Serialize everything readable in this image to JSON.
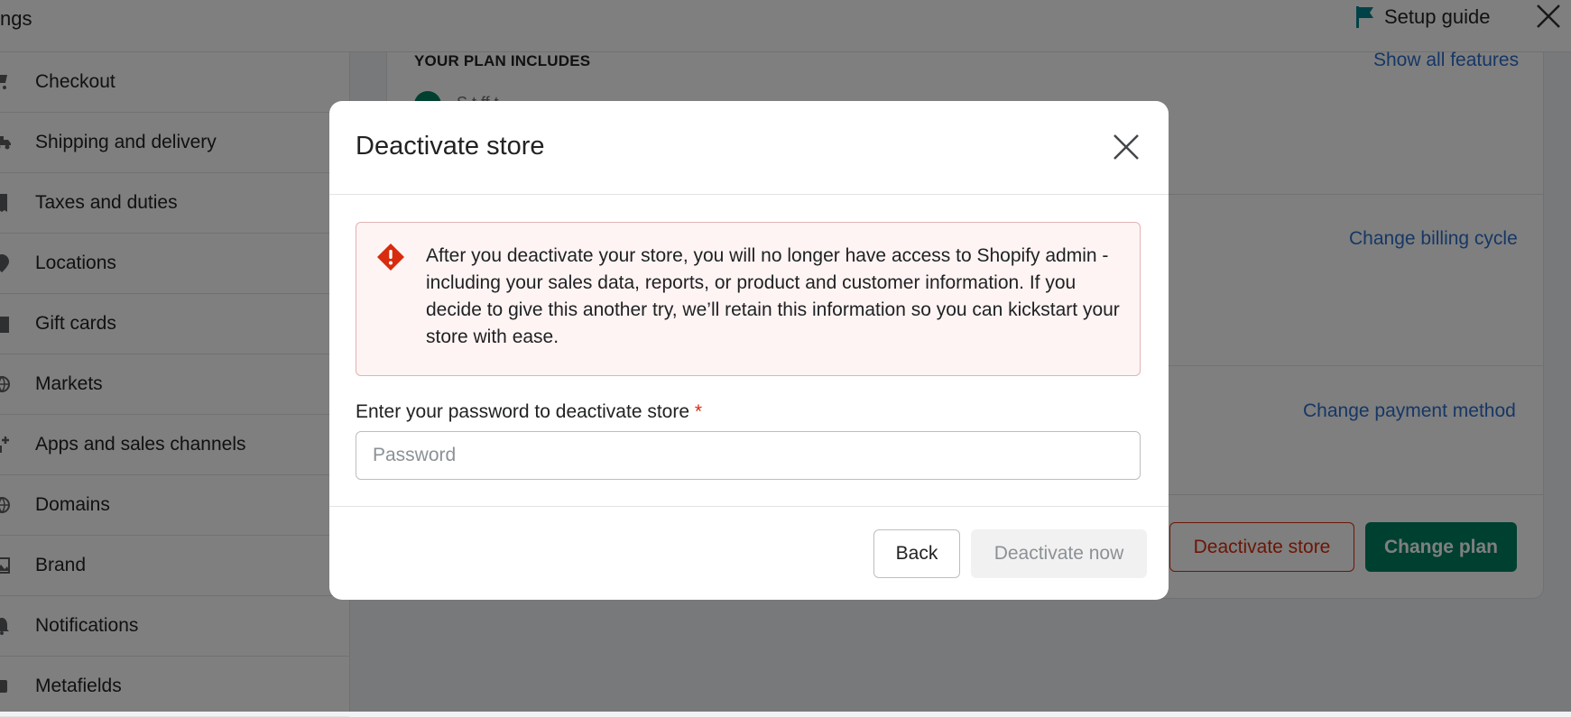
{
  "topbar": {
    "title": "ngs",
    "setup_guide": "Setup guide"
  },
  "sidebar": {
    "items": [
      {
        "label": "Checkout",
        "icon": "cart-icon"
      },
      {
        "label": "Shipping and delivery",
        "icon": "truck-icon"
      },
      {
        "label": "Taxes and duties",
        "icon": "receipt-icon"
      },
      {
        "label": "Locations",
        "icon": "location-pin-icon"
      },
      {
        "label": "Gift cards",
        "icon": "gift-icon"
      },
      {
        "label": "Markets",
        "icon": "globe-icon"
      },
      {
        "label": "Apps and sales channels",
        "icon": "apps-icon"
      },
      {
        "label": "Domains",
        "icon": "globe-icon"
      },
      {
        "label": "Brand",
        "icon": "image-icon"
      },
      {
        "label": "Notifications",
        "icon": "bell-icon"
      },
      {
        "label": "Metafields",
        "icon": "metafields-icon"
      }
    ]
  },
  "main": {
    "plan_includes": "YOUR PLAN INCLUDES",
    "show_all_features": "Show all features",
    "feature_partial": "S  t ff     t",
    "change_billing_cycle": "Change billing cycle",
    "change_payment_method": "Change payment method",
    "deactivate_store_button": "Deactivate store",
    "change_plan_button": "Change plan"
  },
  "modal": {
    "title": "Deactivate store",
    "warning": "After you deactivate your store, you will no longer have access to Shopify admin - including your sales data, reports, or product and customer information. If you decide to give this another try, we’ll retain this information so you can kickstart your store with ease.",
    "password_label": "Enter your password to deactivate store",
    "required_marker": "*",
    "password_value": "",
    "password_placeholder": "Password",
    "back_button": "Back",
    "deactivate_now_button": "Deactivate now"
  },
  "colors": {
    "accent_green": "#008060",
    "critical_red": "#d72c0d",
    "link_blue": "#2c6ecb",
    "banner_bg": "#fff4f4"
  }
}
